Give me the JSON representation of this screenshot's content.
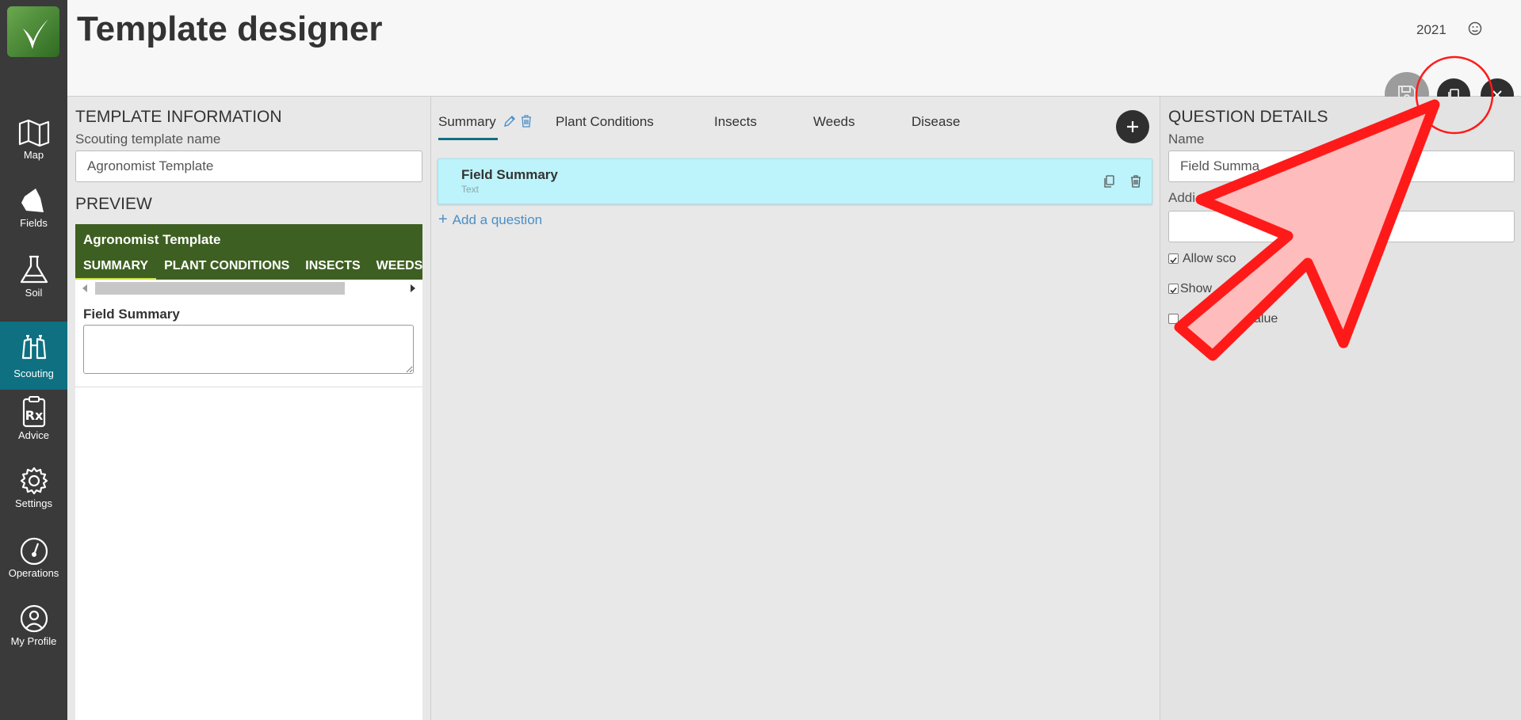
{
  "sidebar": {
    "items": [
      {
        "label": "Map",
        "icon": "map-icon"
      },
      {
        "label": "Fields",
        "icon": "field-icon"
      },
      {
        "label": "Soil",
        "icon": "flask-icon"
      },
      {
        "label": "Scouting",
        "icon": "binoculars-icon",
        "active": true
      },
      {
        "label": "Advice",
        "icon": "prescription-icon"
      },
      {
        "label": "Settings",
        "icon": "gear-icon"
      },
      {
        "label": "Operations",
        "icon": "gauge-icon"
      },
      {
        "label": "My Profile",
        "icon": "user-icon"
      }
    ]
  },
  "header": {
    "title": "Template designer",
    "year": "2021"
  },
  "template_info": {
    "section_title": "TEMPLATE INFORMATION",
    "name_label": "Scouting template name",
    "name_value": "Agronomist Template"
  },
  "preview": {
    "section_title": "PREVIEW",
    "template_title": "Agronomist Template",
    "tabs": [
      "SUMMARY",
      "PLANT CONDITIONS",
      "INSECTS",
      "WEEDS"
    ],
    "field_label": "Field Summary"
  },
  "designer": {
    "tabs": [
      "Summary",
      "Plant Conditions",
      "Insects",
      "Weeds",
      "Disease"
    ],
    "question": {
      "name": "Field Summary",
      "type": "Text"
    },
    "add_question_label": "Add a question"
  },
  "question_details": {
    "section_title": "QUESTION DETAILS",
    "name_label": "Name",
    "name_value": "Field Summa",
    "additional_label": "Addi",
    "additional_value": "",
    "options": [
      {
        "label": "Allow sco",
        "checked": true
      },
      {
        "label": "Show",
        "suffix": "s",
        "checked": true
      },
      {
        "label": "alue",
        "checked": false
      }
    ]
  },
  "colors": {
    "sidebar": "#3a3a3a",
    "active_nav": "#0e7080",
    "preview_header": "#3e5f22",
    "question_card": "#bdf3fb",
    "annotation_red": "#ff1a1a"
  }
}
